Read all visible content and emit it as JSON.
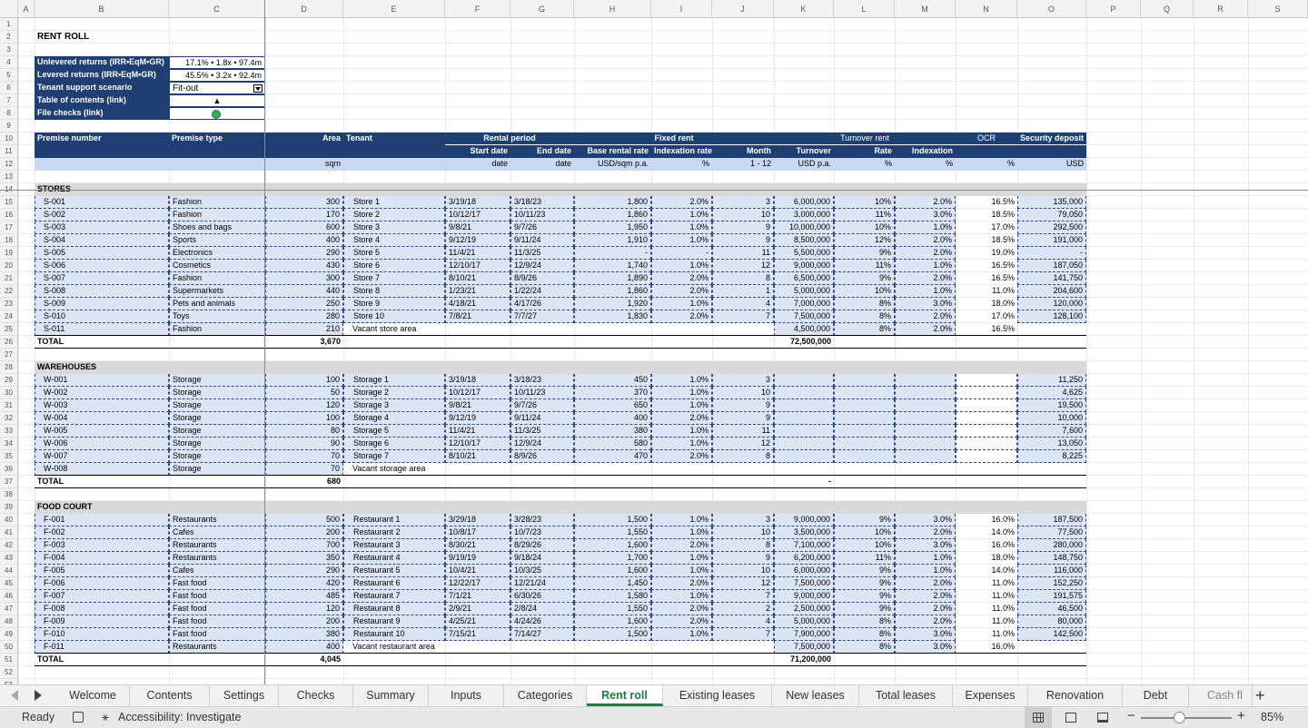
{
  "sheet": {
    "title": "RENT ROLL",
    "columns": [
      "A",
      "B",
      "C",
      "D",
      "E",
      "F",
      "G",
      "H",
      "I",
      "J",
      "K",
      "L",
      "M",
      "N",
      "O",
      "P",
      "Q",
      "R",
      "S"
    ],
    "summary": [
      {
        "label": "Unlevered returns (IRR•EqM•GR)",
        "value": "17.1% • 1.8x • 97.4m"
      },
      {
        "label": "Levered returns (IRR•EqM•GR)",
        "value": "45.5% • 3.2x • 92.4m"
      },
      {
        "label": "Tenant support scenario",
        "value": "Fit-out"
      },
      {
        "label": "Table of contents (link)",
        "value": "▲"
      },
      {
        "label": "File checks (link)",
        "value": ""
      }
    ],
    "status_colors": {
      "check_ok": "#2db34a",
      "header_navy": "#1f3f73",
      "active_tab": "#1b7d3f"
    },
    "headers": {
      "premise_number": "Premise number",
      "premise_type": "Premise type",
      "area": "Area",
      "tenant": "Tenant",
      "rental_period": "Rental period",
      "fixed_rent": "Fixed rent",
      "turnover_rent": "Turnover rent",
      "ocr": "OCR",
      "security_deposit": "Security deposit",
      "start_date": "Start date",
      "end_date": "End date",
      "base_rental_rate": "Base rental rate",
      "indexation_rate": "Indexation rate",
      "month": "Month",
      "turnover": "Turnover",
      "rate": "Rate",
      "indexation": "Indexation",
      "u_area": "sqm",
      "u_start": "date",
      "u_end": "date",
      "u_base": "USD/sqm p.a.",
      "u_idx": "%",
      "u_month": "1 - 12",
      "u_turnover": "USD p.a.",
      "u_rate": "%",
      "u_tidx": "%",
      "u_ocr": "%",
      "u_deposit": "USD"
    },
    "total_label": "TOTAL",
    "sections": [
      {
        "name": "STORES",
        "total_area": "3,670",
        "total_turnover": "72,500,000",
        "rows": [
          [
            "S-001",
            "Fashion",
            "300",
            "Store 1",
            "3/19/18",
            "3/18/23",
            "1,800",
            "2.0%",
            "3",
            "6,000,000",
            "10%",
            "2.0%",
            "16.5%",
            "135,000"
          ],
          [
            "S-002",
            "Fashion",
            "170",
            "Store 2",
            "10/12/17",
            "10/11/23",
            "1,860",
            "1.0%",
            "10",
            "3,000,000",
            "11%",
            "3.0%",
            "18.5%",
            "79,050"
          ],
          [
            "S-003",
            "Shoes and bags",
            "600",
            "Store 3",
            "9/8/21",
            "9/7/26",
            "1,950",
            "1.0%",
            "9",
            "10,000,000",
            "10%",
            "1.0%",
            "17.0%",
            "292,500"
          ],
          [
            "S-004",
            "Sports",
            "400",
            "Store 4",
            "9/12/19",
            "9/11/24",
            "1,910",
            "1.0%",
            "9",
            "8,500,000",
            "12%",
            "2.0%",
            "18.5%",
            "191,000"
          ],
          [
            "S-005",
            "Electronics",
            "290",
            "Store 5",
            "11/4/21",
            "11/3/25",
            "-",
            "-",
            "11",
            "5,500,000",
            "9%",
            "2.0%",
            "19.0%",
            "-"
          ],
          [
            "S-006",
            "Cosmetics",
            "430",
            "Store 6",
            "12/10/17",
            "12/9/24",
            "1,740",
            "1.0%",
            "12",
            "9,000,000",
            "11%",
            "1.0%",
            "16.5%",
            "187,050"
          ],
          [
            "S-007",
            "Fashion",
            "300",
            "Store 7",
            "8/10/21",
            "8/9/26",
            "1,890",
            "2.0%",
            "8",
            "6,500,000",
            "9%",
            "2.0%",
            "16.5%",
            "141,750"
          ],
          [
            "S-008",
            "Supermarkets",
            "440",
            "Store 8",
            "1/23/21",
            "1/22/24",
            "1,860",
            "2.0%",
            "1",
            "5,000,000",
            "10%",
            "1.0%",
            "11.0%",
            "204,600"
          ],
          [
            "S-009",
            "Pets and animals",
            "250",
            "Store 9",
            "4/18/21",
            "4/17/26",
            "1,920",
            "1.0%",
            "4",
            "7,000,000",
            "8%",
            "3.0%",
            "18.0%",
            "120,000"
          ],
          [
            "S-010",
            "Toys",
            "280",
            "Store 10",
            "7/8/21",
            "7/7/27",
            "1,830",
            "2.0%",
            "7",
            "7,500,000",
            "8%",
            "2.0%",
            "17.0%",
            "128,100"
          ],
          [
            "S-011",
            "Fashion",
            "210",
            "Vacant store area",
            "",
            "",
            "",
            "",
            "",
            "4,500,000",
            "8%",
            "2.0%",
            "16.5%",
            ""
          ]
        ]
      },
      {
        "name": "WAREHOUSES",
        "total_area": "680",
        "total_turnover": "-",
        "rows": [
          [
            "W-001",
            "Storage",
            "100",
            "Storage 1",
            "3/19/18",
            "3/18/23",
            "450",
            "1.0%",
            "3",
            "",
            "",
            "",
            "",
            "11,250"
          ],
          [
            "W-002",
            "Storage",
            "50",
            "Storage 2",
            "10/12/17",
            "10/11/23",
            "370",
            "1.0%",
            "10",
            "",
            "",
            "",
            "",
            "4,625"
          ],
          [
            "W-003",
            "Storage",
            "120",
            "Storage 3",
            "9/8/21",
            "9/7/26",
            "650",
            "1.0%",
            "9",
            "",
            "",
            "",
            "",
            "19,500"
          ],
          [
            "W-004",
            "Storage",
            "100",
            "Storage 4",
            "9/12/19",
            "9/11/24",
            "400",
            "2.0%",
            "9",
            "",
            "",
            "",
            "",
            "10,000"
          ],
          [
            "W-005",
            "Storage",
            "80",
            "Storage 5",
            "11/4/21",
            "11/3/25",
            "380",
            "1.0%",
            "11",
            "",
            "",
            "",
            "",
            "7,600"
          ],
          [
            "W-006",
            "Storage",
            "90",
            "Storage 6",
            "12/10/17",
            "12/9/24",
            "580",
            "1.0%",
            "12",
            "",
            "",
            "",
            "",
            "13,050"
          ],
          [
            "W-007",
            "Storage",
            "70",
            "Storage 7",
            "8/10/21",
            "8/9/26",
            "470",
            "2.0%",
            "8",
            "",
            "",
            "",
            "",
            "8,225"
          ],
          [
            "W-008",
            "Storage",
            "70",
            "Vacant storage area",
            "",
            "",
            "",
            "",
            "",
            "",
            "",
            "",
            "",
            ""
          ]
        ]
      },
      {
        "name": "FOOD COURT",
        "total_area": "4,045",
        "total_turnover": "71,200,000",
        "rows": [
          [
            "F-001",
            "Restaurants",
            "500",
            "Restaurant 1",
            "3/29/18",
            "3/28/23",
            "1,500",
            "1.0%",
            "3",
            "9,000,000",
            "9%",
            "3.0%",
            "16.0%",
            "187,500"
          ],
          [
            "F-002",
            "Cafes",
            "200",
            "Restaurant 2",
            "10/8/17",
            "10/7/23",
            "1,550",
            "1.0%",
            "10",
            "3,500,000",
            "10%",
            "2.0%",
            "14.0%",
            "77,500"
          ],
          [
            "F-003",
            "Restaurants",
            "700",
            "Restaurant 3",
            "8/30/21",
            "8/29/26",
            "1,600",
            "2.0%",
            "8",
            "7,100,000",
            "10%",
            "3.0%",
            "16.0%",
            "280,000"
          ],
          [
            "F-004",
            "Restaurants",
            "350",
            "Restaurant 4",
            "9/19/19",
            "9/18/24",
            "1,700",
            "1.0%",
            "9",
            "6,200,000",
            "11%",
            "1.0%",
            "18.0%",
            "148,750"
          ],
          [
            "F-005",
            "Cafes",
            "290",
            "Restaurant 5",
            "10/4/21",
            "10/3/25",
            "1,600",
            "1.0%",
            "10",
            "6,000,000",
            "9%",
            "1.0%",
            "14.0%",
            "116,000"
          ],
          [
            "F-006",
            "Fast food",
            "420",
            "Restaurant 6",
            "12/22/17",
            "12/21/24",
            "1,450",
            "2.0%",
            "12",
            "7,500,000",
            "9%",
            "2.0%",
            "11.0%",
            "152,250"
          ],
          [
            "F-007",
            "Fast food",
            "485",
            "Restaurant 7",
            "7/1/21",
            "6/30/26",
            "1,580",
            "1.0%",
            "7",
            "9,000,000",
            "9%",
            "2.0%",
            "11.0%",
            "191,575"
          ],
          [
            "F-008",
            "Fast food",
            "120",
            "Restaurant 8",
            "2/9/21",
            "2/8/24",
            "1,550",
            "2.0%",
            "2",
            "2,500,000",
            "9%",
            "2.0%",
            "11.0%",
            "46,500"
          ],
          [
            "F-009",
            "Fast food",
            "200",
            "Restaurant 9",
            "4/25/21",
            "4/24/26",
            "1,600",
            "2.0%",
            "4",
            "5,000,000",
            "8%",
            "2.0%",
            "11.0%",
            "80,000"
          ],
          [
            "F-010",
            "Fast food",
            "380",
            "Restaurant 10",
            "7/15/21",
            "7/14/27",
            "1,500",
            "1.0%",
            "7",
            "7,900,000",
            "8%",
            "3.0%",
            "11.0%",
            "142,500"
          ],
          [
            "F-011",
            "Restaurants",
            "400",
            "Vacant restaurant area",
            "",
            "",
            "",
            "",
            "",
            "7,500,000",
            "8%",
            "3.0%",
            "16.0%",
            ""
          ]
        ]
      }
    ]
  },
  "tabs": [
    "Welcome",
    "Contents",
    "Settings",
    "Checks",
    "Summary",
    "Inputs",
    "Categories",
    "Rent roll",
    "Existing leases",
    "New leases",
    "Total leases",
    "Expenses",
    "Renovation",
    "Debt",
    "Cash fl"
  ],
  "active_tab": "Rent roll",
  "status_bar": {
    "ready": "Ready",
    "accessibility": "Accessibility: Investigate",
    "zoom": "85%"
  },
  "icons": {
    "prev": "left-arrow",
    "next": "right-arrow",
    "add": "plus",
    "macro": "macro-icon",
    "accessibility": "accessibility-icon",
    "normal_view": "grid-icon",
    "page_layout": "page-layout-icon",
    "page_break": "page-break-icon"
  }
}
